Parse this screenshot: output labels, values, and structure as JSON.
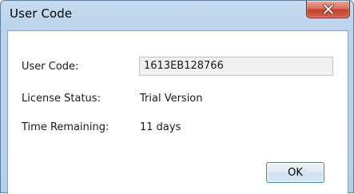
{
  "window": {
    "title": "User Code"
  },
  "fields": {
    "user_code_label": "User Code:",
    "user_code_value": "1613EB128766",
    "license_status_label": "License Status:",
    "license_status_value": "Trial Version",
    "time_remaining_label": "Time Remaining:",
    "time_remaining_value": "11 days"
  },
  "buttons": {
    "ok_label": "OK",
    "close_icon": "close-icon"
  },
  "colors": {
    "close_button": "#c9503a",
    "ok_border": "#3c7fb1",
    "frame": "#bcd3ec"
  }
}
